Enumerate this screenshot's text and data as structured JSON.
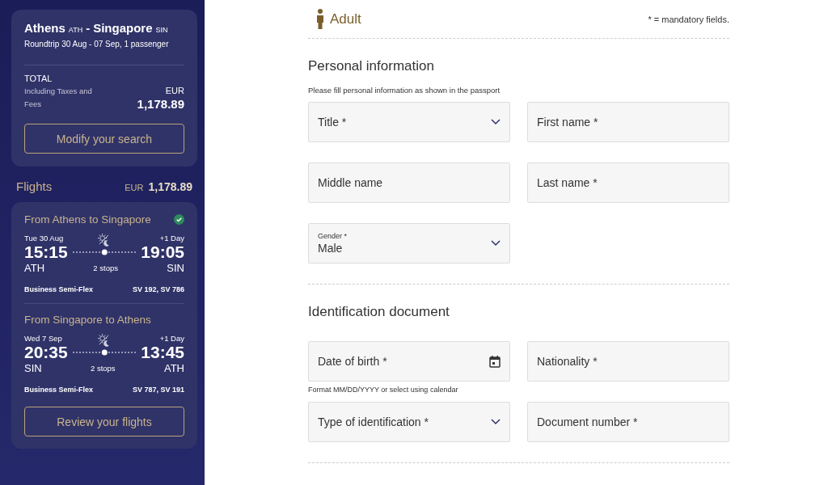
{
  "summary": {
    "from": "Athens",
    "from_code": "ATH",
    "separator": "-",
    "to": "Singapore",
    "to_code": "SIN",
    "trip": "Roundtrip 30 Aug - 07 Sep, 1 passenger",
    "total_label": "TOTAL",
    "total_note": "Including Taxes and Fees",
    "currency": "EUR",
    "amount": "1,178.89",
    "button": "Modify your search"
  },
  "flights_header": {
    "label": "Flights",
    "currency": "EUR",
    "amount": "1,178.89"
  },
  "legs": [
    {
      "title": "From Athens to Singapore",
      "confirmed": true,
      "date": "Tue 30 Aug",
      "day_offset": "+1 Day",
      "dep_time": "15:15",
      "arr_time": "19:05",
      "dep_code": "ATH",
      "arr_code": "SIN",
      "stops": "2 stops",
      "fare": "Business Semi-Flex",
      "flight_numbers": "SV 192, SV 786"
    },
    {
      "title": "From Singapore to Athens",
      "confirmed": false,
      "date": "Wed 7 Sep",
      "day_offset": "+1 Day",
      "dep_time": "20:35",
      "arr_time": "13:45",
      "dep_code": "SIN",
      "arr_code": "ATH",
      "stops": "2 stops",
      "fare": "Business Semi-Flex",
      "flight_numbers": "SV 787, SV 191"
    }
  ],
  "review_button": "Review your flights",
  "form": {
    "passenger_type": "Adult",
    "mandatory_note": "* = mandatory fields.",
    "sections": [
      {
        "title": "Personal information",
        "hint": "Please fill personal information as shown in the passport",
        "fields": [
          {
            "kind": "select",
            "label": "Title *"
          },
          {
            "kind": "text",
            "label": "First name *"
          },
          {
            "kind": "text",
            "label": "Middle name"
          },
          {
            "kind": "text",
            "label": "Last name *"
          },
          {
            "kind": "select",
            "label": "Gender *",
            "value": "Male"
          }
        ]
      },
      {
        "title": "Identification document",
        "fields": [
          {
            "kind": "date",
            "label": "Date of birth *",
            "help": "Format MM/DD/YYYY or select using calendar"
          },
          {
            "kind": "text",
            "label": "Nationality *"
          },
          {
            "kind": "select",
            "label": "Type of identification *"
          },
          {
            "kind": "text",
            "label": "Document number *"
          }
        ]
      }
    ]
  }
}
